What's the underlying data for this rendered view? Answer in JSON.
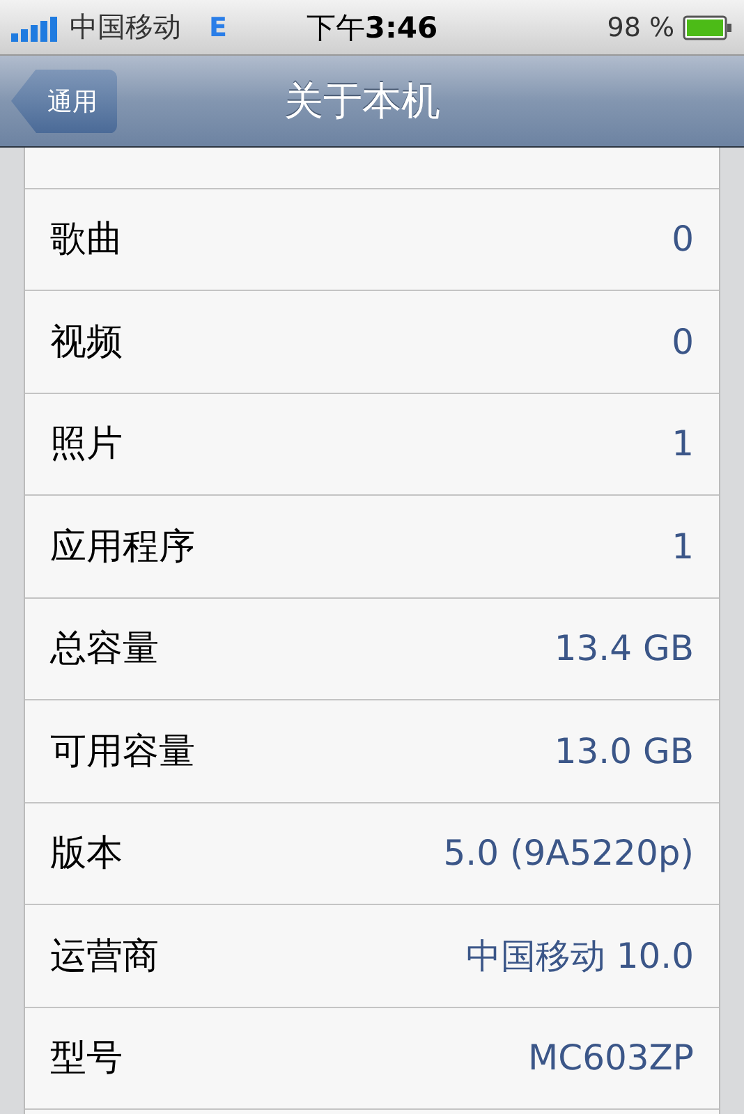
{
  "status_bar": {
    "carrier": "中国移动",
    "network": "E",
    "time_prefix": "下午",
    "time": "3:46",
    "battery": "98 %"
  },
  "nav_bar": {
    "back_button": "通用",
    "title": "关于本机"
  },
  "rows": [
    {
      "label": "歌曲",
      "value": "0"
    },
    {
      "label": "视频",
      "value": "0"
    },
    {
      "label": "照片",
      "value": "1"
    },
    {
      "label": "应用程序",
      "value": "1"
    },
    {
      "label": "总容量",
      "value": "13.4 GB"
    },
    {
      "label": "可用容量",
      "value": "13.0 GB"
    },
    {
      "label": "版本",
      "value": "5.0 (9A5220p)"
    },
    {
      "label": "运营商",
      "value": "中国移动 10.0"
    },
    {
      "label": "型号",
      "value": "MC603ZP"
    }
  ]
}
